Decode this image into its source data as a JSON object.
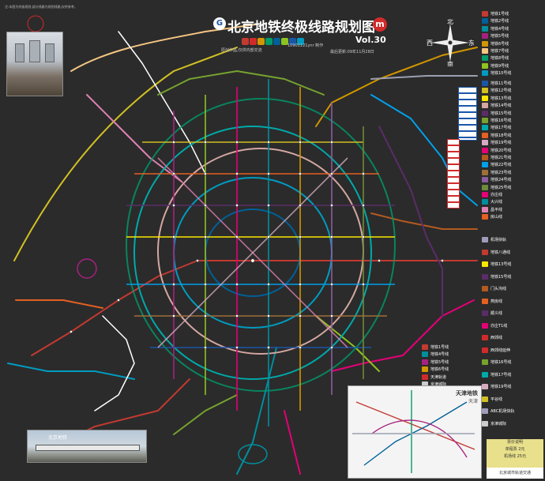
{
  "header": {
    "title": "北京地铁终极线路规划图",
    "logo_left": "G",
    "logo_right": "m",
    "version": "Vol.30",
    "credit": "原创作品,仅供内部交流",
    "author": "10901121ynr 制作",
    "updated": "最后更新:09年11月28日"
  },
  "compass": {
    "north": "北",
    "south": "南",
    "east": "东",
    "west": "西"
  },
  "legend_right_top": [
    {
      "label": "地铁1号线",
      "color": "#c23a30"
    },
    {
      "label": "地铁2号线",
      "color": "#006098"
    },
    {
      "label": "地铁4号线",
      "color": "#008e9c"
    },
    {
      "label": "地铁5号线",
      "color": "#a6217f"
    },
    {
      "label": "地铁6号线",
      "color": "#d29700"
    },
    {
      "label": "地铁7号线",
      "color": "#f6c582"
    },
    {
      "label": "地铁8号线",
      "color": "#009b6b"
    },
    {
      "label": "地铁9号线",
      "color": "#8fc31f"
    },
    {
      "label": "地铁10号线",
      "color": "#009bc0"
    }
  ],
  "legend_right_mid": [
    {
      "label": "地铁11号线",
      "color": "#1a56a8"
    },
    {
      "label": "地铁12号线",
      "color": "#d1c023"
    },
    {
      "label": "地铁13号线",
      "color": "#f9e700"
    },
    {
      "label": "地铁14号线",
      "color": "#d5a7a1"
    },
    {
      "label": "地铁15号线",
      "color": "#5b2c68"
    },
    {
      "label": "地铁16号线",
      "color": "#76a32e"
    },
    {
      "label": "地铁17号线",
      "color": "#00a9a9"
    },
    {
      "label": "地铁18号线",
      "color": "#e46022"
    },
    {
      "label": "地铁19号线",
      "color": "#d6abc1"
    },
    {
      "label": "地铁20号线",
      "color": "#e40077"
    },
    {
      "label": "地铁21号线",
      "color": "#b35a20"
    },
    {
      "label": "地铁22号线",
      "color": "#00a0e9"
    },
    {
      "label": "地铁23号线",
      "color": "#9e6f37"
    },
    {
      "label": "地铁24号线",
      "color": "#8a5d9e"
    },
    {
      "label": "地铁25号线",
      "color": "#6f8a3a"
    },
    {
      "label": "亦庄线",
      "color": "#e40077"
    },
    {
      "label": "大兴线",
      "color": "#008e9c"
    },
    {
      "label": "昌平线",
      "color": "#de82b2"
    },
    {
      "label": "房山线",
      "color": "#e46022"
    }
  ],
  "legend_right_bottom": [
    {
      "label": "机场快轨",
      "color": "#a29bbb"
    },
    {
      "label": "地铁八通线",
      "color": "#c23a30"
    },
    {
      "label": "地铁13号线",
      "color": "#f9e700"
    },
    {
      "label": "地铁15号线",
      "color": "#5b2c68"
    },
    {
      "label": "门头沟线",
      "color": "#b35a20"
    },
    {
      "label": "燕房线",
      "color": "#e46022"
    },
    {
      "label": "顺义线",
      "color": "#5b2c68"
    },
    {
      "label": "亦庄T1线",
      "color": "#e40077"
    },
    {
      "label": "西郊线",
      "color": "#d12a2a"
    },
    {
      "label": "西郊线延伸",
      "color": "#d12a2a"
    },
    {
      "label": "地铁16号线",
      "color": "#76a32e"
    },
    {
      "label": "地铁17号线",
      "color": "#00a9a9"
    },
    {
      "label": "地铁19号线",
      "color": "#d6abc1"
    },
    {
      "label": "平谷线",
      "color": "#d1c023"
    },
    {
      "label": "ABC机场快轨",
      "color": "#a29bbb"
    },
    {
      "label": "京津城际",
      "color": "#cccccc"
    }
  ],
  "side_legend": [
    {
      "label": "地铁1号线",
      "color": "#c23a30"
    },
    {
      "label": "地铁4号线",
      "color": "#008e9c"
    },
    {
      "label": "地铁5号线",
      "color": "#a6217f"
    },
    {
      "label": "地铁6号线",
      "color": "#d29700"
    },
    {
      "label": "天津轨道",
      "color": "#d12a2a"
    },
    {
      "label": "京津城际",
      "color": "#cccccc"
    }
  ],
  "inset": {
    "title": "天津地铁",
    "subtitle": "天津"
  },
  "fare": {
    "line1": "票价说明",
    "line2": "单程票 2元",
    "line3": "机场线 25元",
    "footer": "北京城市轨道交通"
  },
  "photo_caption": "北京地铁",
  "notes_top_left": "注:本图为终极规划,部分线路为规划线路,仅供参考。"
}
